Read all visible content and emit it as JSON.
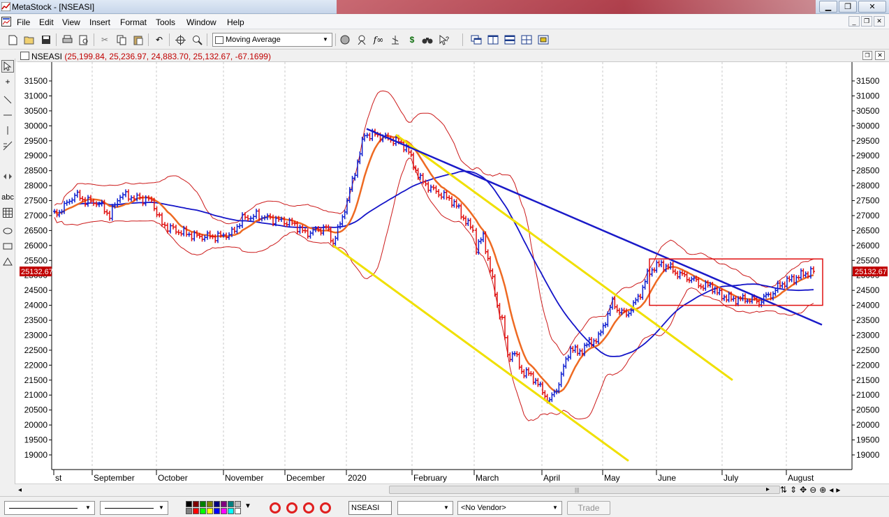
{
  "window": {
    "title": "MetaStock - [NSEASI]",
    "buttons": [
      "minimize",
      "maximize",
      "close"
    ]
  },
  "menu": [
    "File",
    "Edit",
    "View",
    "Insert",
    "Format",
    "Tools",
    "Window",
    "Help"
  ],
  "toolbar": {
    "indicator_select": "Moving Average",
    "icons": [
      "new-icon",
      "open-icon",
      "save-icon",
      "print-icon",
      "print-preview-icon",
      "cut-icon",
      "copy-icon",
      "paste-icon",
      "undo-icon",
      "crosshair-icon",
      "zoom-icon",
      "indicator-builder-icon",
      "explorer-icon",
      "expert-advisor-icon",
      "system-tester-icon",
      "dollar-icon",
      "binoculars-icon",
      "help-icon",
      "cascade-icon",
      "tile-vertical-icon",
      "tile-horizontal-icon",
      "tile-grid-icon",
      "arrange-icon"
    ]
  },
  "chart_window": {
    "symbol": "NSEASI",
    "quote": "(25,199.84, 25,236.97, 24,883.70, 25,132.67, -67.1699)",
    "last_price_tag": "25132.67"
  },
  "left_tools": [
    "pointer-icon",
    "crosshair-tool-icon",
    "trendline-icon",
    "horizontal-line-icon",
    "vertical-line-icon",
    "fibonacci-icon",
    "text-abc-icon",
    "grid-icon",
    "ellipse-icon",
    "rectangle-icon",
    "triangle-icon"
  ],
  "colors": {
    "up_bar": "#1020d0",
    "down_bar": "#e01010",
    "ma_long": "#1414c8",
    "ma_short": "#ee6a22",
    "bollinger": "#cc1a1a",
    "trend_channel": "#f0e000",
    "trendline": "#1a1ac8",
    "box": "#e01010"
  },
  "chart_data": {
    "type": "candlestick",
    "symbol": "NSEASI",
    "xlabel": "",
    "ylabel": "",
    "ylim": [
      18500,
      32000
    ],
    "y_ticks": [
      19000,
      19500,
      20000,
      20500,
      21000,
      21500,
      22000,
      22500,
      23000,
      23500,
      24000,
      24500,
      25000,
      25500,
      26000,
      26500,
      27000,
      27500,
      28000,
      28500,
      29000,
      29500,
      30000,
      30500,
      31000,
      31500
    ],
    "x_tick_labels": [
      "st",
      "September",
      "October",
      "November",
      "December",
      "2020",
      "February",
      "March",
      "April",
      "May",
      "June",
      "July",
      "August"
    ],
    "grid": "vertical-dashed",
    "close_series_approx": [
      {
        "x": "Aug-2019",
        "y": 27000
      },
      {
        "x": "Sep-2019",
        "y": 27600
      },
      {
        "x": "Sep-2019b",
        "y": 27200
      },
      {
        "x": "Oct-2019",
        "y": 27500
      },
      {
        "x": "Oct-2019b",
        "y": 26600
      },
      {
        "x": "Nov-2019",
        "y": 26300
      },
      {
        "x": "Nov-2019b",
        "y": 26900
      },
      {
        "x": "Dec-2019",
        "y": 26600
      },
      {
        "x": "Dec-2019b",
        "y": 26200
      },
      {
        "x": "Jan-2020",
        "y": 29500
      },
      {
        "x": "Jan-2020b",
        "y": 29600
      },
      {
        "x": "Feb-2020",
        "y": 28000
      },
      {
        "x": "Feb-2020b",
        "y": 27300
      },
      {
        "x": "Mar-2020",
        "y": 26000
      },
      {
        "x": "Mar-2020b",
        "y": 22500
      },
      {
        "x": "Apr-2020",
        "y": 21500
      },
      {
        "x": "Apr-2020b",
        "y": 20800
      },
      {
        "x": "May-2020",
        "y": 22600
      },
      {
        "x": "May-2020b",
        "y": 24000
      },
      {
        "x": "Jun-2020",
        "y": 25300
      },
      {
        "x": "Jun-2020b",
        "y": 24900
      },
      {
        "x": "Jul-2020",
        "y": 24100
      },
      {
        "x": "Jul-2020b",
        "y": 24200
      },
      {
        "x": "Aug-2020",
        "y": 24800
      },
      {
        "x": "Aug-2020b",
        "y": 25132.67
      }
    ],
    "last_value": 25132.67
  },
  "hscroll": {
    "left_arrow": "◂",
    "right_arrow": "▸"
  },
  "bottom": {
    "symbol_field": "NSEASI",
    "period_select": "",
    "vendor_select": "<No Vendor>",
    "trade_button": "Trade",
    "palette": [
      "#000000",
      "#7f0000",
      "#007f00",
      "#7f7f00",
      "#00007f",
      "#7f007f",
      "#007f7f",
      "#c0c0c0",
      "#808080",
      "#ff0000",
      "#00ff00",
      "#ffff00",
      "#0000ff",
      "#ff00ff",
      "#00ffff",
      "#ffffff"
    ]
  }
}
